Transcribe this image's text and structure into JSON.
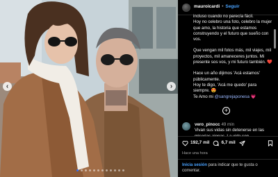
{
  "post": {
    "username": "mauroicardi",
    "separator": "•",
    "follow_label": "Seguir",
    "photo_description_icon": "photo-carousel",
    "carousel": {
      "dots": 12,
      "active_index": 0
    },
    "nav": {
      "prev": "‹",
      "next": "›"
    }
  },
  "caption": {
    "paragraphs": [
      "incluso cuando no parecía fácil.\nHoy no celebro una foto, celebro la mujer que amo, la historia que estamos construyendo y el futuro que sueño con vos.",
      "Que vengan mil fotos más, mil viajes, mil proyectos, mil amaneceres juntos. Mi presente sos vos, y mi futuro también. ❤️",
      "Hace un año dijimos 'Acá estamos' públicamente.\nHoy te digo, 'Acá me quedo' para siempre. 😍"
    ],
    "last_line_prefix": "Te Amo mi ",
    "last_line_mention": "@sangrejaponesa",
    "last_line_suffix": " 💗"
  },
  "more_replies_label": "+",
  "comment": {
    "username": "vero_pinocc",
    "time": "49 min",
    "text": "Vivan sus vidas sin detenerse en las miserias ajenas. La vida son"
  },
  "actions": {
    "likes": "192,7 mil",
    "comments": "6,7 mil",
    "time_ago": "Hace una hora"
  },
  "login_prompt": {
    "link": "Inicia sesión",
    "text": " para indicar que te gusta o comentar."
  },
  "colors": {
    "accent_blue": "#4aa3ff",
    "active_dot": "#2f6cf6",
    "panel_bg": "#000000"
  }
}
